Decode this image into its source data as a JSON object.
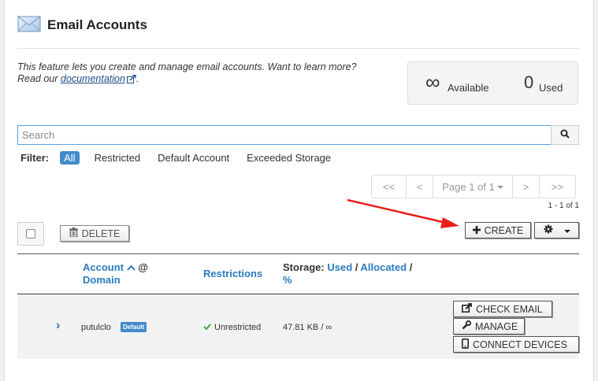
{
  "header": {
    "title": "Email Accounts",
    "icon": "envelope-icon"
  },
  "description": {
    "text": "This feature lets you create and manage email accounts. Want to learn more? Read our",
    "link_text": "documentation",
    "suffix": "."
  },
  "quota": {
    "available_symbol": "∞",
    "available_label": "Available",
    "used_value": "0",
    "used_label": "Used"
  },
  "search": {
    "placeholder": "Search",
    "value": ""
  },
  "filter": {
    "label": "Filter:",
    "active": "All",
    "options": [
      "Restricted",
      "Default Account",
      "Exceeded Storage"
    ]
  },
  "pager": {
    "first": "<<",
    "prev": "<",
    "page_label": "Page 1 of 1",
    "next": ">",
    "last": ">>",
    "range": "1 - 1 of 1"
  },
  "toolbar": {
    "delete_label": "DELETE",
    "create_label": "CREATE"
  },
  "table": {
    "headers": {
      "account": "Account",
      "at": "@",
      "domain": "Domain",
      "restrictions": "Restrictions",
      "storage": "Storage:",
      "used": "Used",
      "sep1": "/",
      "allocated": "Allocated",
      "sep2": "/",
      "percent": "%"
    },
    "rows": [
      {
        "user": "putulclo",
        "badge": "Default",
        "restriction": "Unrestricted",
        "storage": "47.81 KB / ∞",
        "actions": {
          "check_email": "CHECK EMAIL",
          "manage": "MANAGE",
          "connect": "CONNECT DEVICES"
        }
      }
    ]
  },
  "colors": {
    "accent": "#428bca",
    "link": "#2a7bbf",
    "annotation_arrow": "#e8201c"
  }
}
